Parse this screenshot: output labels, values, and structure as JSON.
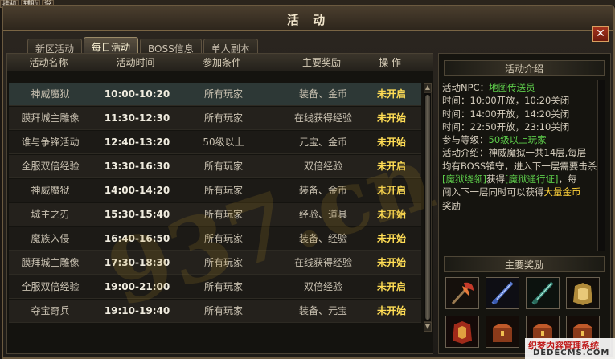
{
  "top_menu": [
    "挂机",
    "辅助",
    "说"
  ],
  "window": {
    "title": "活 动",
    "close_label": "✕"
  },
  "tabs": [
    {
      "label": "新区活动",
      "active": false
    },
    {
      "label": "每日活动",
      "active": true
    },
    {
      "label": "BOSS信息",
      "active": false
    },
    {
      "label": "单人副本",
      "active": false
    }
  ],
  "table": {
    "headers": {
      "name": "活动名称",
      "time": "活动时间",
      "condition": "参加条件",
      "reward": "主要奖励",
      "op": "操 作"
    },
    "rows": [
      {
        "name": "神威魔狱",
        "time": "10:00-10:20",
        "condition": "所有玩家",
        "reward": "装备、金币",
        "op": "未开启"
      },
      {
        "name": "膜拜城主雕像",
        "time": "11:30-12:30",
        "condition": "所有玩家",
        "reward": "在线获得经验",
        "op": "未开始"
      },
      {
        "name": "谁与争锋活动",
        "time": "12:40-13:20",
        "condition": "50级以上",
        "reward": "元宝、金币",
        "op": "未开始"
      },
      {
        "name": "全服双倍经验",
        "time": "13:30-16:30",
        "condition": "所有玩家",
        "reward": "双倍经验",
        "op": "未开启"
      },
      {
        "name": "神威魔狱",
        "time": "14:00-14:20",
        "condition": "所有玩家",
        "reward": "装备、金币",
        "op": "未开启"
      },
      {
        "name": "城主之刃",
        "time": "15:30-15:40",
        "condition": "所有玩家",
        "reward": "经验、道具",
        "op": "未开始"
      },
      {
        "name": "魔族入侵",
        "time": "16:40-16:50",
        "condition": "所有玩家",
        "reward": "装备、经验",
        "op": "未开始"
      },
      {
        "name": "膜拜城主雕像",
        "time": "17:30-18:30",
        "condition": "所有玩家",
        "reward": "在线获得经验",
        "op": "未开始"
      },
      {
        "name": "全服双倍经验",
        "time": "19:00-21:00",
        "condition": "所有玩家",
        "reward": "双倍经验",
        "op": "未开启"
      },
      {
        "name": "夺宝奇兵",
        "time": "19:10-19:40",
        "condition": "所有玩家",
        "reward": "装备、元宝",
        "op": "未开始"
      }
    ]
  },
  "watermark": "937.cn",
  "details": {
    "header": "活动介绍",
    "npc_label": "活动NPC：",
    "npc_value": "地图传送员",
    "time1": "时间：10:00开放，10:20关闭",
    "time2": "时间：14:00开放，14:20关闭",
    "time3": "时间：22:50开放，23:10关闭",
    "level_label": "参与等级：",
    "level_value": "50级以上玩家",
    "intro1": "活动介绍：神威魔狱一共14层,每层",
    "intro2": "均有BOSS镇守，进入下一层需要击杀",
    "intro3_a": "[魔狱绕领]",
    "intro3_b": "获得",
    "intro3_c": "[魔狱通行证]",
    "intro3_d": "，每",
    "intro4_a": "闯入下一层同时可以获得",
    "intro4_b": "大量金币",
    "intro5": "奖励"
  },
  "rewards": {
    "header": "主要奖励",
    "items": [
      "axe-icon",
      "blue-sword-icon",
      "green-sword-icon",
      "gold-armor-icon",
      "red-armor-icon",
      "treasure-box-icon",
      "treasure-box-icon",
      "treasure-box-icon"
    ]
  },
  "corner_logo": {
    "line1": "织梦内容管理系统",
    "line2": "DEDECMS.COM"
  }
}
